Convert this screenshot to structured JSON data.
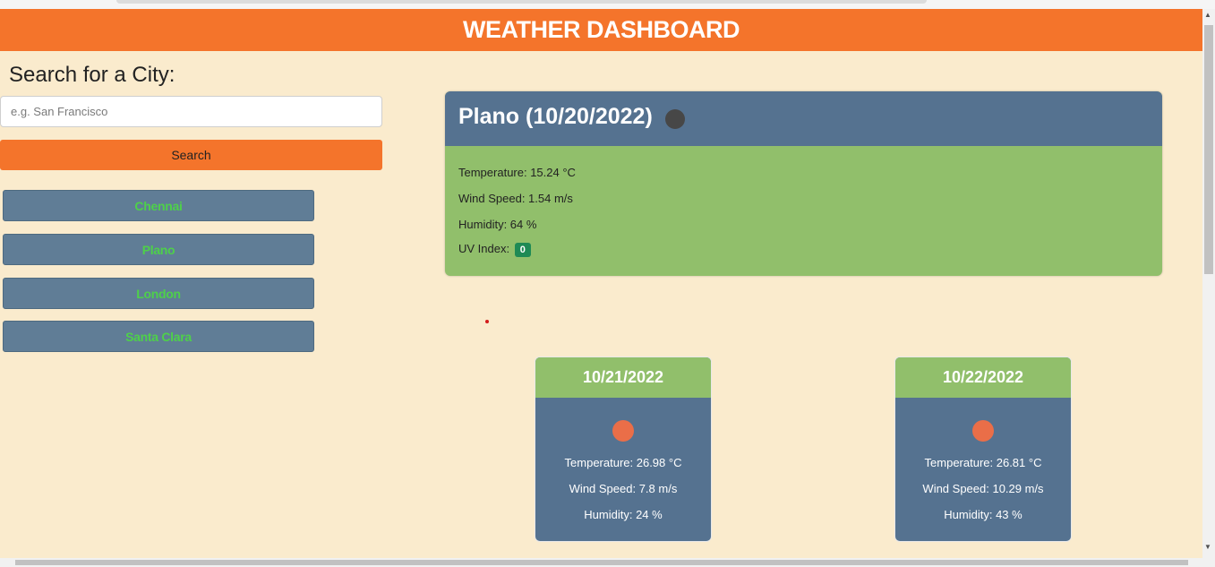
{
  "header": {
    "title": "WEATHER DASHBOARD"
  },
  "search": {
    "title": "Search for a City:",
    "placeholder": "e.g. San Francisco",
    "button_label": "Search"
  },
  "history": [
    {
      "label": "Chennai"
    },
    {
      "label": "Plano"
    },
    {
      "label": "London"
    },
    {
      "label": "Santa Clara"
    }
  ],
  "current": {
    "title": "Plano (10/20/2022)",
    "icon": "dark-circle-icon",
    "temperature": "Temperature: 15.24 °C",
    "wind": "Wind Speed: 1.54 m/s",
    "humidity": "Humidity: 64 %",
    "uv_label": "UV Index:",
    "uv_value": "0"
  },
  "forecast": [
    {
      "date": "10/21/2022",
      "icon": "sun-icon",
      "temperature": "Temperature: 26.98 °C",
      "wind": "Wind Speed: 7.8 m/s",
      "humidity": "Humidity: 24 %"
    },
    {
      "date": "10/22/2022",
      "icon": "sun-icon",
      "temperature": "Temperature: 26.81 °C",
      "wind": "Wind Speed: 10.29 m/s",
      "humidity": "Humidity: 43 %"
    }
  ],
  "colors": {
    "background": "#faebcd",
    "header": "#f4742b",
    "card_blue": "#557290",
    "card_green": "#91bf6b",
    "city_button": "#607d96",
    "city_text": "#4ed04a",
    "uv_badge": "#1f8a55"
  }
}
